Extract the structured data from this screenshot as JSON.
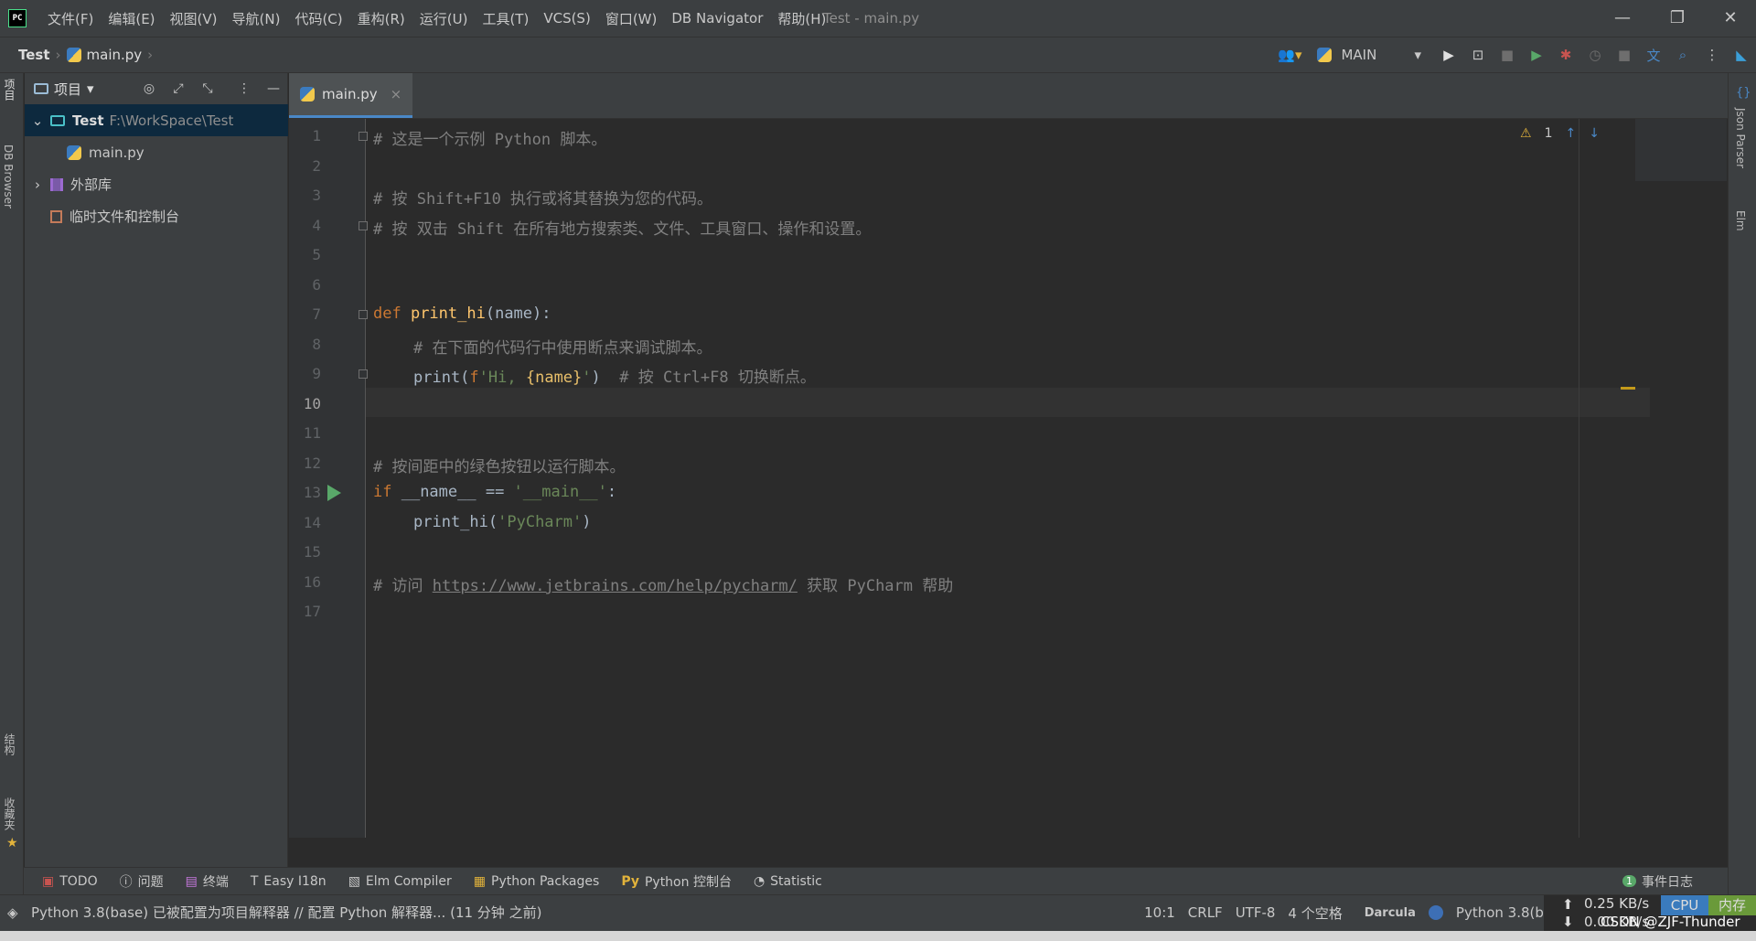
{
  "app": {
    "logo_text": "PC",
    "window_title": "Test - main.py"
  },
  "menu": [
    "文件(F)",
    "编辑(E)",
    "视图(V)",
    "导航(N)",
    "代码(C)",
    "重构(R)",
    "运行(U)",
    "工具(T)",
    "VCS(S)",
    "窗口(W)",
    "DB Navigator",
    "帮助(H)"
  ],
  "breadcrumb": {
    "project": "Test",
    "file": "main.py"
  },
  "run_config": {
    "name": "MAIN"
  },
  "left_strip": {
    "project_tab": "项目",
    "db_browser_tab": "DB Browser",
    "structure_tab": "结构",
    "favorites_tab": "收藏夹"
  },
  "project_panel": {
    "title": "项目",
    "tree": [
      {
        "label": "Test",
        "path": "F:\\WorkSpace\\Test"
      },
      {
        "label": "main.py"
      },
      {
        "label": "外部库"
      },
      {
        "label": "临时文件和控制台"
      }
    ]
  },
  "editor": {
    "tab": "main.py",
    "inspection_count": "1",
    "line_numbers": [
      "1",
      "2",
      "3",
      "4",
      "5",
      "6",
      "7",
      "8",
      "9",
      "10",
      "11",
      "12",
      "13",
      "14",
      "15",
      "16",
      "17"
    ],
    "lines": {
      "l1": "# 这是一个示例 Python 脚本。",
      "l3": "# 按 Shift+F10 执行或将其替换为您的代码。",
      "l4": "# 按 双击 Shift 在所有地方搜索类、文件、工具窗口、操作和设置。",
      "l7_kw": "def ",
      "l7_fn": "print_hi",
      "l7_rest": "(name):",
      "l8": "# 在下面的代码行中使用断点来调试脚本。",
      "l9_a": "print(",
      "l9_f": "f",
      "l9_s1": "'Hi, ",
      "l9_br": "{name}",
      "l9_s2": "'",
      "l9_b": ")",
      "l9_cm": "# 按 Ctrl+F8 切换断点。",
      "l12": "# 按间距中的绿色按钮以运行脚本。",
      "l13_kw": "if ",
      "l13_mid": "__name__ == ",
      "l13_st": "'__main__'",
      "l13_end": ":",
      "l14_a": "print_hi(",
      "l14_st": "'PyCharm'",
      "l14_b": ")",
      "l16_a": "# 访问 ",
      "l16_link": "https://www.jetbrains.com/help/pycharm/",
      "l16_b": " 获取 PyCharm 帮助"
    }
  },
  "right_strip": {
    "json_parser_tab": "Json Parser",
    "elm_tab": "Elm"
  },
  "bottom_tools": [
    "TODO",
    "问题",
    "终端",
    "Easy I18n",
    "Elm Compiler",
    "Python Packages",
    "Python 控制台",
    "Statistic"
  ],
  "event_log": {
    "count": "1",
    "label": "事件日志"
  },
  "status": {
    "message": "Python 3.8(base) 已被配置为项目解释器 // 配置 Python 解释器... (11 分钟 之前)",
    "position": "10:1",
    "line_sep": "CRLF",
    "encoding": "UTF-8",
    "indent": "4 个空格",
    "theme": "Darcula",
    "interpreter": "Python 3.8(base)"
  },
  "net_monitor": {
    "upload": "0.25 KB/s",
    "download": "0.00 KB/s",
    "cpu_label": "CPU",
    "mem_label": "内存",
    "watermark": "CSDN @ZJF-Thunder"
  },
  "colors": {
    "accent": "#4a88c7",
    "run_green": "#59a869",
    "debug_red": "#c75450",
    "warning": "#c49a1a"
  }
}
